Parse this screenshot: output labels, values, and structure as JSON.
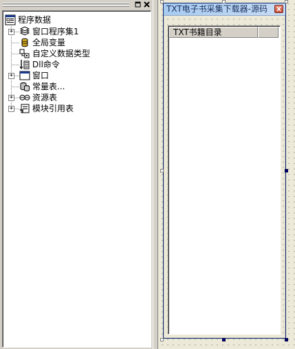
{
  "tree_panel": {
    "buttons": {
      "restore_icon": "restore-icon",
      "restore_label": "▫",
      "close_icon": "close-icon",
      "close_label": "✕"
    },
    "root": {
      "label": "程序数据",
      "icon": "program-data-icon"
    },
    "items": [
      {
        "label": "窗口程序集1",
        "icon": "assembly-icon",
        "expander": "+"
      },
      {
        "label": "全局变量",
        "icon": "global-variable-icon",
        "expander": ""
      },
      {
        "label": "自定义数据类型",
        "icon": "custom-type-icon",
        "expander": ""
      },
      {
        "label": "Dll命令",
        "icon": "dll-command-icon",
        "expander": ""
      },
      {
        "label": "窗口",
        "icon": "window-icon",
        "expander": "+"
      },
      {
        "label": "常量表...",
        "icon": "constant-table-icon",
        "expander": ""
      },
      {
        "label": "资源表",
        "icon": "resource-table-icon",
        "expander": "+"
      },
      {
        "label": "模块引用表",
        "icon": "module-reference-icon",
        "expander": "+"
      }
    ]
  },
  "form": {
    "title": "TXT电子书采集下载器-源码",
    "close_label": "✕",
    "listview": {
      "columns": [
        "TXT书籍目录",
        ""
      ]
    }
  },
  "colors": {
    "chrome": "#d4d0c8",
    "titlebar_start": "#a6caf0",
    "titlebar_end": "#c9ddf4",
    "handle_selected": "#000080",
    "close_button": "#c44b36"
  }
}
